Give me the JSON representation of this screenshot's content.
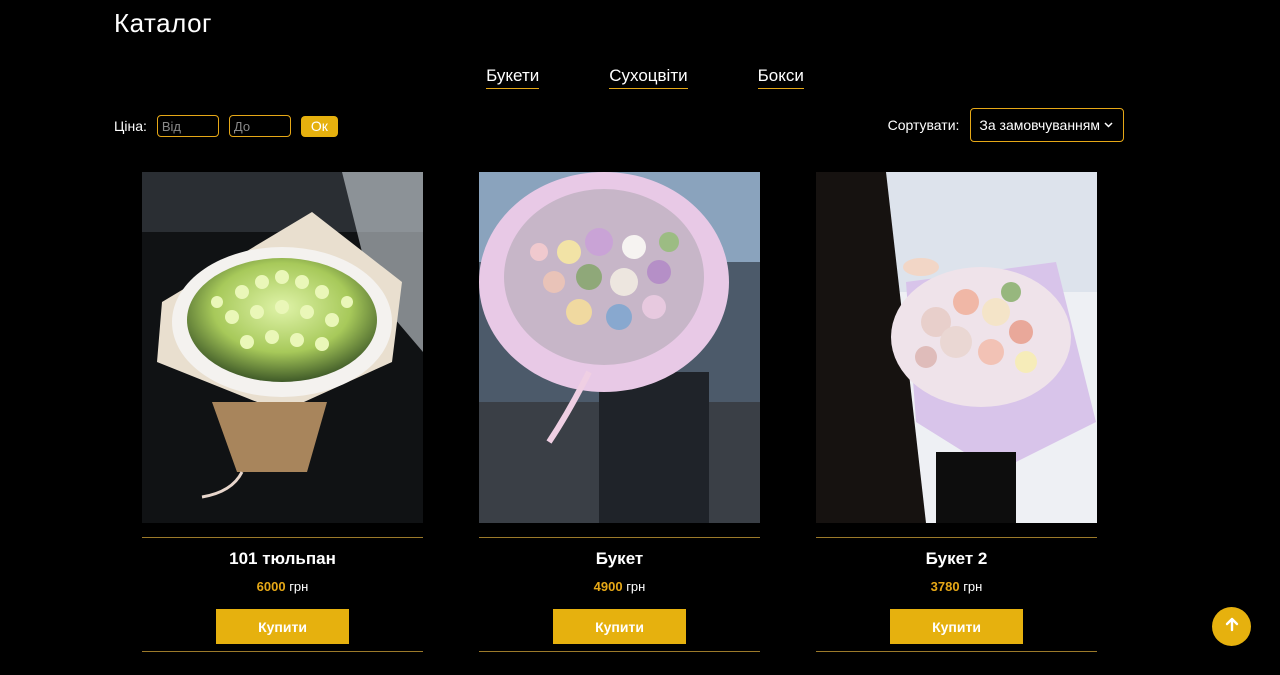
{
  "header": {
    "title": "Каталог"
  },
  "tabs": [
    {
      "label": "Букети"
    },
    {
      "label": "Сухоцвіти"
    },
    {
      "label": "Бокси"
    }
  ],
  "filter": {
    "label": "Ціна:",
    "from_placeholder": "Від",
    "to_placeholder": "До",
    "ok_label": "Ок"
  },
  "sort": {
    "label": "Сортувати:",
    "selected": "За замовчуванням",
    "icon": "chevron-down-icon"
  },
  "products": [
    {
      "name": "101 тюльпан",
      "price": "6000",
      "currency": "грн",
      "buy_label": "Купити",
      "image": "tulip-bouquet-photo"
    },
    {
      "name": "Букет",
      "price": "4900",
      "currency": "грн",
      "buy_label": "Купити",
      "image": "mixed-bouquet-photo"
    },
    {
      "name": "Букет 2",
      "price": "3780",
      "currency": "грн",
      "buy_label": "Купити",
      "image": "pink-bouquet-photo"
    }
  ],
  "scroll_top": {
    "icon": "arrow-up-icon"
  },
  "colors": {
    "accent": "#e6b10e",
    "background": "#000000",
    "text": "#ffffff"
  }
}
